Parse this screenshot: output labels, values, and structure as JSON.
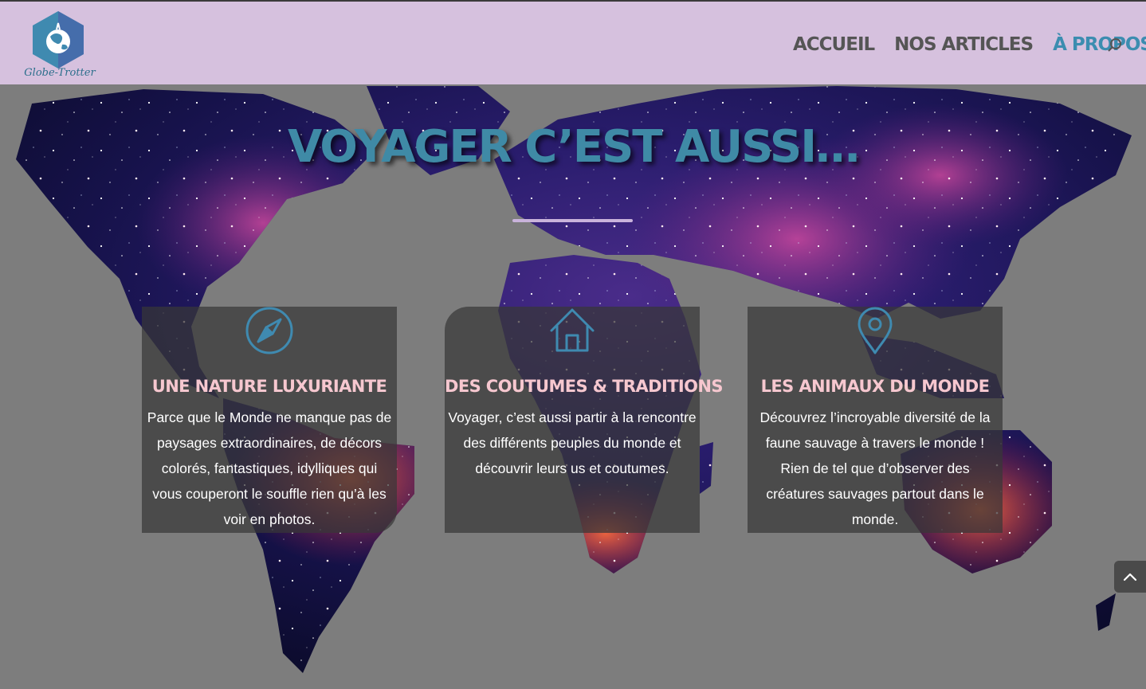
{
  "header": {
    "logo_text": "Globe-Trotter",
    "nav": [
      {
        "label": "ACCUEIL",
        "active": false
      },
      {
        "label": "NOS ARTICLES",
        "active": false
      },
      {
        "label": "À PROPOS",
        "active": true
      }
    ],
    "search_icon": "search-icon"
  },
  "hero": {
    "title": "VOYAGER C’EST AUSSI…"
  },
  "cards": [
    {
      "icon": "compass-icon",
      "title": "UNE NATURE LUXURIANTE",
      "text": "Parce que le Monde ne manque pas de paysages extraordinaires, de décors colorés, fantastiques, idylliques qui vous couperont le souffle rien qu’à les voir en photos."
    },
    {
      "icon": "home-icon",
      "title": "DES COUTUMES & TRADITIONS",
      "text": "Voyager, c’est aussi partir à la rencontre des différents peuples du monde et découvrir leurs us et coutumes."
    },
    {
      "icon": "map-pin-icon",
      "title": "LES ANIMAUX DU MONDE",
      "text": "Découvrez l’incroyable diversité de la faune sauvage à travers le monde ! Rien de tel que d’observer des créatures sauvages partout dans le monde."
    }
  ],
  "colors": {
    "header_bg": "#d6c1de",
    "nav_text": "#555555",
    "nav_active": "#3c8db0",
    "hero_title": "#3f8aa6",
    "card_title": "#f6c7cf",
    "page_bg": "#7d7d7d"
  },
  "scroll_top_icon": "chevron-up-icon"
}
